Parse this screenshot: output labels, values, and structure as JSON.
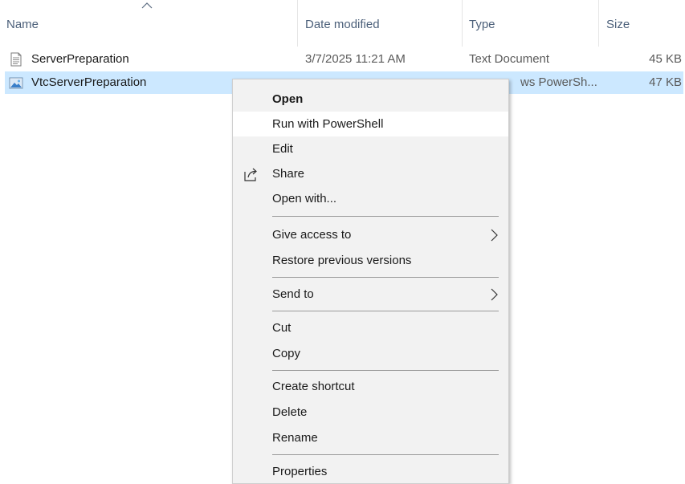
{
  "columns": {
    "name": "Name",
    "date_modified": "Date modified",
    "type": "Type",
    "size": "Size"
  },
  "files": [
    {
      "name": "ServerPreparation",
      "date": "3/7/2025 11:21 AM",
      "type": "Text Document",
      "size": "45 KB",
      "icon": "text-document-icon"
    },
    {
      "name": "VtcServerPreparation",
      "date": "",
      "type": "ws PowerSh...",
      "size": "47 KB",
      "icon": "powershell-script-icon",
      "selected": true
    }
  ],
  "context_menu": {
    "items": {
      "open": "Open",
      "run_with_powershell": "Run with PowerShell",
      "edit": "Edit",
      "share": "Share",
      "open_with": "Open with...",
      "give_access_to": "Give access to",
      "restore_previous_versions": "Restore previous versions",
      "send_to": "Send to",
      "cut": "Cut",
      "copy": "Copy",
      "create_shortcut": "Create shortcut",
      "delete": "Delete",
      "rename": "Rename",
      "properties": "Properties"
    },
    "hovered_item": "Run with PowerShell"
  },
  "colors": {
    "selection": "#cce8ff",
    "menu_background": "#f2f2f2",
    "menu_hover": "#ffffff",
    "header_text": "#4c607a"
  }
}
